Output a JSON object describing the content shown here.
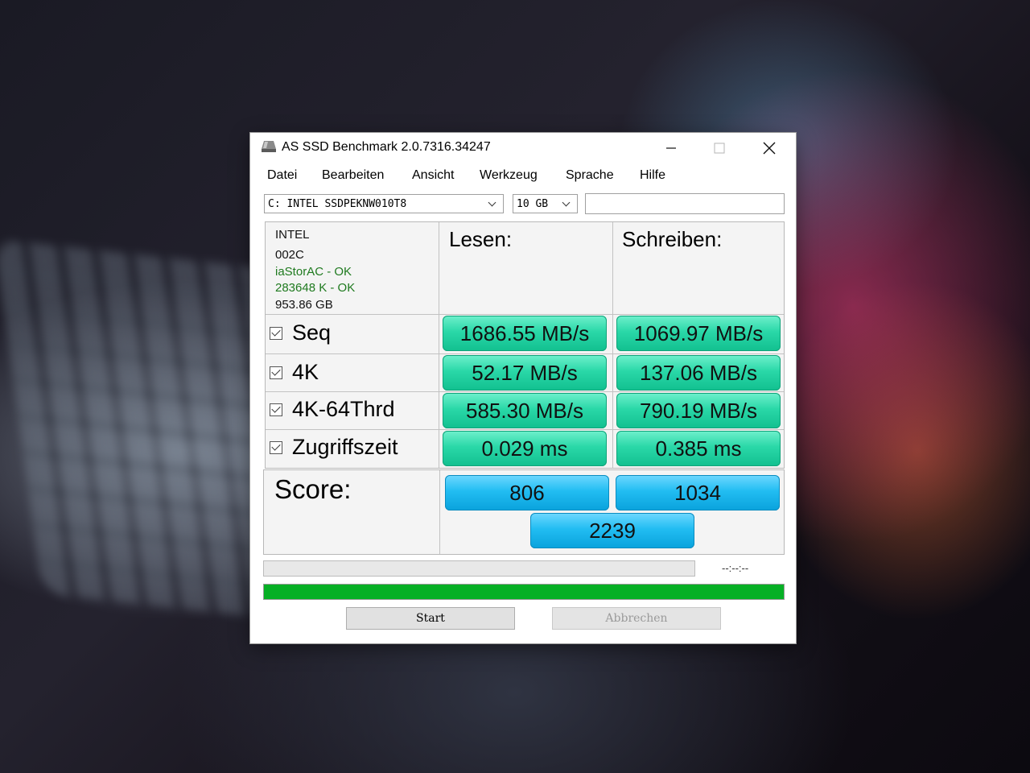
{
  "window": {
    "title": "AS SSD Benchmark 2.0.7316.34247"
  },
  "menu": [
    "Datei",
    "Bearbeiten",
    "Ansicht",
    "Werkzeug",
    "Sprache",
    "Hilfe"
  ],
  "drive_select": {
    "value": "C: INTEL SSDPEKNW010T8"
  },
  "size_select": {
    "value": "10 GB"
  },
  "drive_info": {
    "vendor": "INTEL",
    "firmware": "002C",
    "driver": "iaStorAC - OK",
    "alignment": "283648 K - OK",
    "capacity": "953.86 GB"
  },
  "columns": {
    "read": "Lesen:",
    "write": "Schreiben:"
  },
  "rows": [
    {
      "label": "Seq",
      "checked": true,
      "read": "1686.55 MB/s",
      "write": "1069.97 MB/s"
    },
    {
      "label": "4K",
      "checked": true,
      "read": "52.17 MB/s",
      "write": "137.06 MB/s"
    },
    {
      "label": "4K-64Thrd",
      "checked": true,
      "read": "585.30 MB/s",
      "write": "790.19 MB/s"
    },
    {
      "label": "Zugriffszeit",
      "checked": true,
      "read": "0.029 ms",
      "write": "0.385 ms"
    }
  ],
  "score": {
    "label": "Score:",
    "read": "806",
    "write": "1034",
    "total": "2239"
  },
  "progress": {
    "time": "--:--:--",
    "fraction": 1.0
  },
  "buttons": {
    "start": "Start",
    "cancel": "Abbrechen"
  },
  "colors": {
    "result_green": "#2ad8a8",
    "score_blue": "#22bdf2",
    "progress_green": "#06b025"
  }
}
